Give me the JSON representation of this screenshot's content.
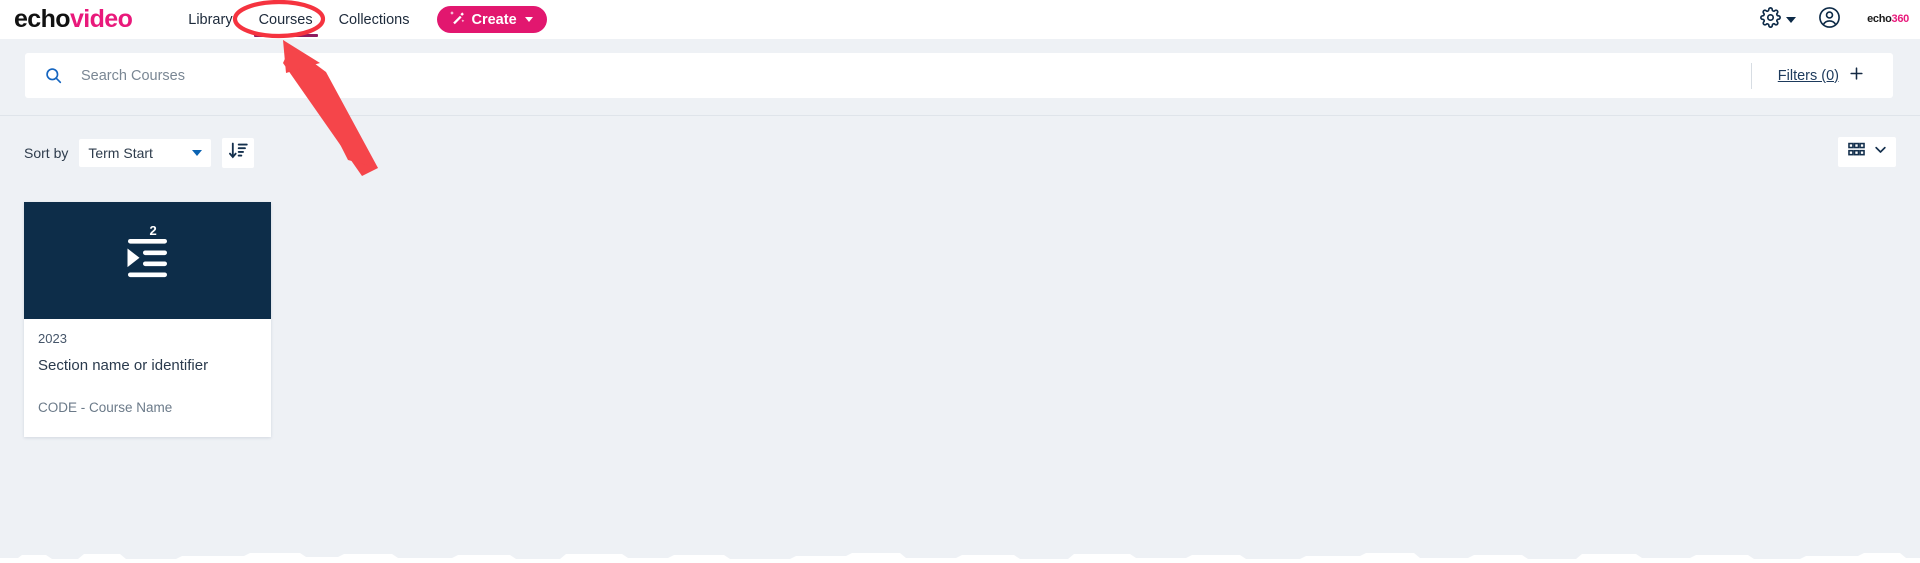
{
  "header": {
    "logo_echo": "echo",
    "logo_video": "video",
    "nav": [
      {
        "label": "Library",
        "active": false
      },
      {
        "label": "Courses",
        "active": true
      },
      {
        "label": "Collections",
        "active": false
      }
    ],
    "create_label": "Create",
    "create_icon": "magic-wand-icon",
    "gear_icon": "gear-icon",
    "gear_caret_icon": "chevron-down-icon",
    "avatar_icon": "user-avatar-icon",
    "brand_echo": "echo",
    "brand_360": "360"
  },
  "search": {
    "placeholder": "Search Courses",
    "value": "",
    "icon": "search-icon",
    "filters_label": "Filters (0)",
    "filters_add_icon": "plus-icon"
  },
  "sort": {
    "label": "Sort by",
    "selected": "Term Start",
    "options": [
      "Term Start"
    ],
    "direction_icon": "sort-descending-icon",
    "view_icon": "grid-view-icon",
    "view_caret_icon": "chevron-down-icon"
  },
  "courses": [
    {
      "year": "2023",
      "section": "Section name or identifier",
      "code": "CODE - Course Name",
      "count": "2",
      "thumb_icon": "playlist-play-icon"
    }
  ],
  "annotations": {
    "ellipse_target": "Courses",
    "ellipse_color": "#f5333f",
    "arrow_color": "#f5454a"
  },
  "colors": {
    "brand_pink": "#e2176f",
    "page_background": "#eef1f5",
    "thumb_background": "#0d2d49",
    "active_tab_underline": "#8f1b5f"
  }
}
